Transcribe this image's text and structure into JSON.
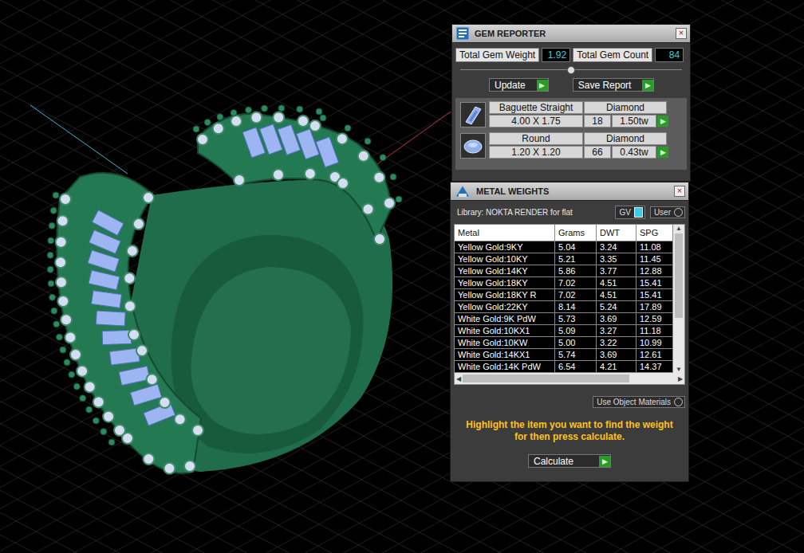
{
  "viewport": {
    "grid": true
  },
  "gem_reporter": {
    "title": "GEM REPORTER",
    "close": "×",
    "total_weight_label": "Total Gem Weight",
    "total_weight": "1.92",
    "total_count_label": "Total Gem Count",
    "total_count": "84",
    "slider": {
      "level": 0.5
    },
    "buttons": [
      {
        "label": "Update",
        "arrow": "▶"
      },
      {
        "label": "Save Report",
        "arrow": "▶"
      }
    ],
    "gems": [
      {
        "kind": "baguette",
        "shape": "Baguette Straight",
        "material": "Diamond",
        "size": "4.00 X 1.75",
        "count": "18",
        "weight": "1.50tw",
        "arrow": "▶"
      },
      {
        "kind": "round",
        "shape": "Round",
        "material": "Diamond",
        "size": "1.20 X 1.20",
        "count": "66",
        "weight": "0.43tw",
        "arrow": "▶"
      }
    ]
  },
  "metal_weights": {
    "title": "METAL WEIGHTS",
    "close": "×",
    "library": "Library: NOKTA RENDER for flat",
    "toggles": [
      {
        "label": "GV",
        "on": true
      },
      {
        "label": "User",
        "on": false
      }
    ],
    "columns": [
      "Metal",
      "Grams",
      "DWT",
      "SPG"
    ],
    "rows": [
      [
        "Yellow Gold:9KY",
        "5.04",
        "3.24",
        "11.08"
      ],
      [
        "Yellow Gold:10KY",
        "5.21",
        "3.35",
        "11.45"
      ],
      [
        "Yellow Gold:14KY",
        "5.86",
        "3.77",
        "12.88"
      ],
      [
        "Yellow Gold:18KY",
        "7.02",
        "4.51",
        "15.41"
      ],
      [
        "Yellow Gold:18KY R",
        "7.02",
        "4.51",
        "15.41"
      ],
      [
        "Yellow Gold:22KY",
        "8.14",
        "5.24",
        "17.89"
      ],
      [
        "White Gold:9K PdW",
        "5.73",
        "3.69",
        "12.59"
      ],
      [
        "White Gold:10KX1",
        "5.09",
        "3.27",
        "11.18"
      ],
      [
        "White Gold:10KW",
        "5.00",
        "3.22",
        "10.99"
      ],
      [
        "White Gold:14KX1",
        "5.74",
        "3.69",
        "12.61"
      ],
      [
        "White Gold:14K PdW",
        "6.54",
        "4.21",
        "14.37"
      ]
    ],
    "scroll_up": "▲",
    "scroll_down": "▼",
    "scroll_left": "◀",
    "scroll_right": "▶",
    "use_object_materials": {
      "label": "Use Object Materials",
      "on": false
    },
    "hint": "Highlight the item you want to find the weight for then press calculate.",
    "calculate": {
      "label": "Calculate",
      "arrow": "▶"
    }
  }
}
